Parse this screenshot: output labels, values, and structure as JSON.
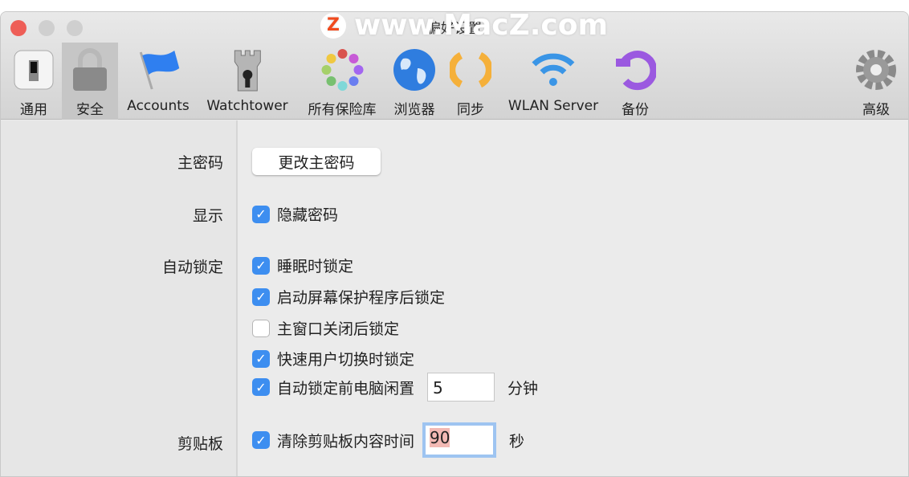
{
  "window": {
    "title": "偏好设置",
    "watermark": "www.MacZ.com",
    "watermark_logo": "Z"
  },
  "toolbar": [
    {
      "label": "通用",
      "icon": "switch-icon"
    },
    {
      "label": "安全",
      "icon": "lock-icon",
      "selected": true
    },
    {
      "label": "Accounts",
      "icon": "flag-icon"
    },
    {
      "label": "Watchtower",
      "icon": "tower-icon"
    },
    {
      "label": "所有保险库",
      "icon": "vaults-icon"
    },
    {
      "label": "浏览器",
      "icon": "globe-icon"
    },
    {
      "label": "同步",
      "icon": "sync-icon"
    },
    {
      "label": "WLAN Server",
      "icon": "wifi-icon"
    },
    {
      "label": "备份",
      "icon": "backup-icon"
    },
    {
      "label": "高级",
      "icon": "gear-icon"
    }
  ],
  "security": {
    "master_password": {
      "label": "主密码",
      "button": "更改主密码"
    },
    "display": {
      "label": "显示",
      "hide_passwords": {
        "label": "隐藏密码",
        "checked": true
      }
    },
    "autolock": {
      "label": "自动锁定",
      "options": [
        {
          "label": "睡眠时锁定",
          "checked": true
        },
        {
          "label": "启动屏幕保护程序后锁定",
          "checked": true
        },
        {
          "label": "主窗口关闭后锁定",
          "checked": false
        },
        {
          "label": "快速用户切换时锁定",
          "checked": true
        }
      ],
      "idle": {
        "label": "自动锁定前电脑闲置",
        "checked": true,
        "value": "5",
        "unit": "分钟"
      }
    },
    "clipboard": {
      "label": "剪贴板",
      "clear": {
        "label": "清除剪贴板内容时间",
        "checked": true,
        "value": "90",
        "unit": "秒"
      }
    }
  },
  "colors": {
    "accent": "#3d8ef0",
    "close": "#ee5e57"
  }
}
